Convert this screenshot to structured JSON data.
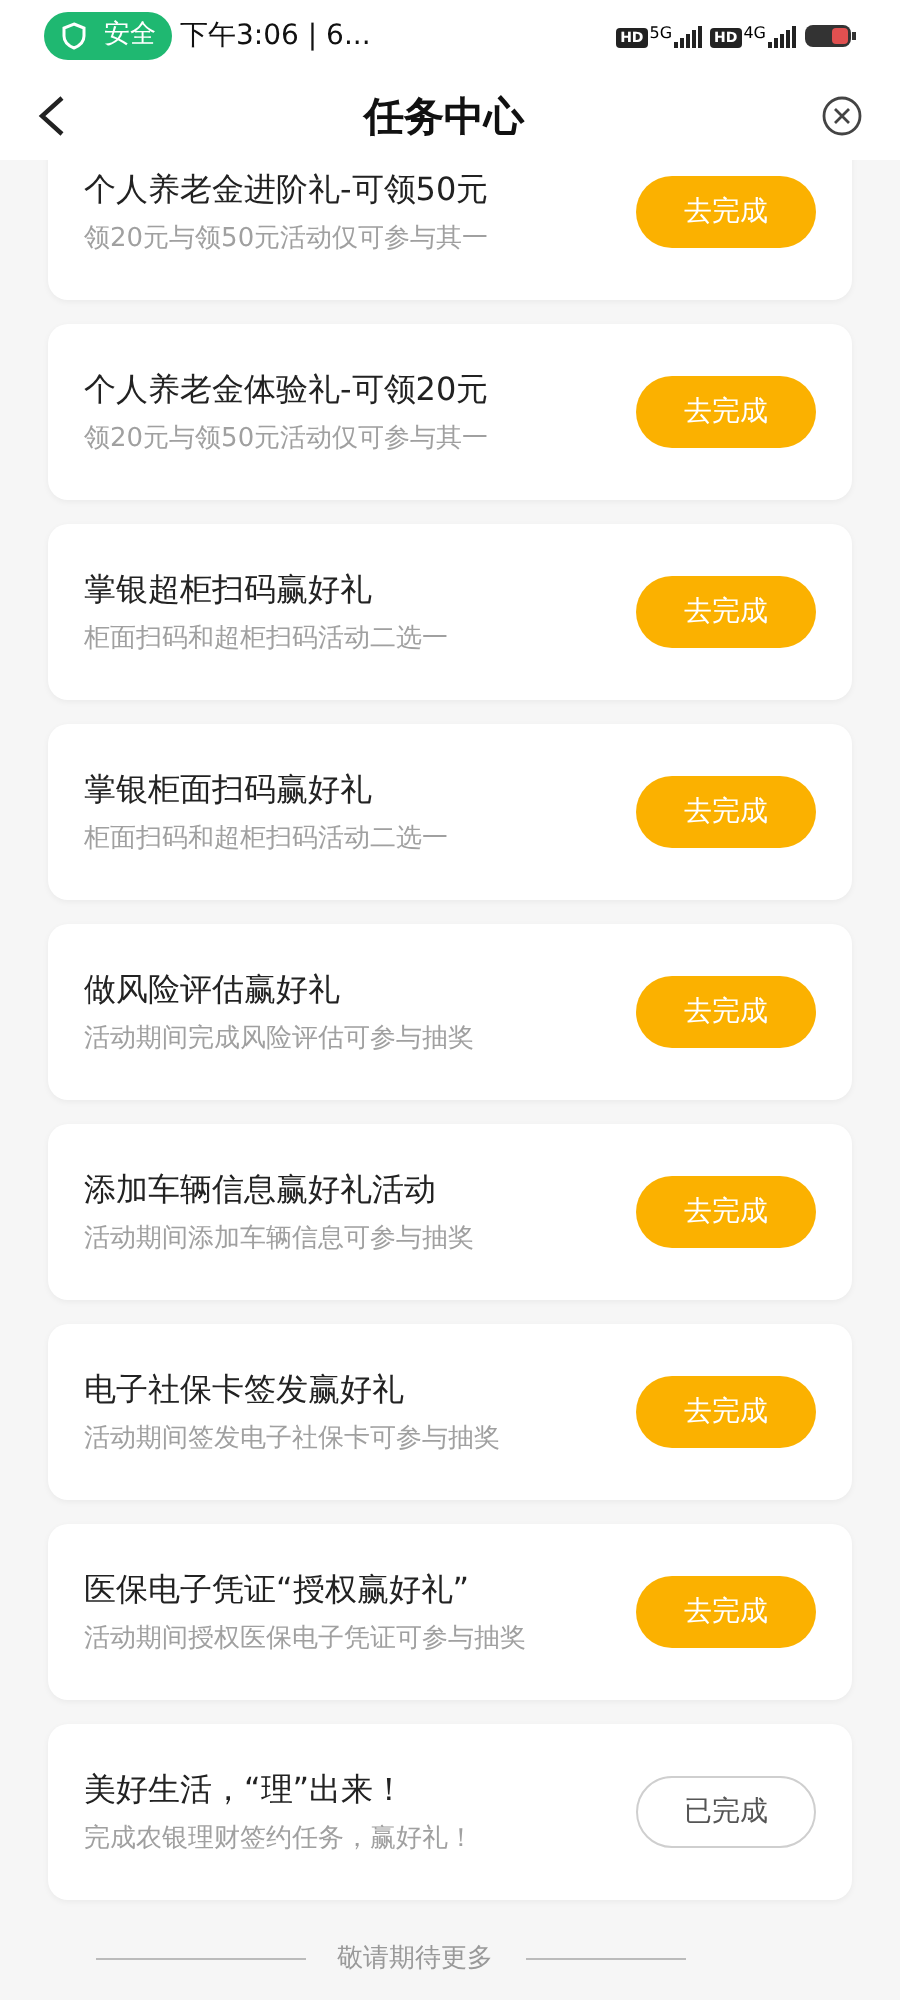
{
  "status_bar": {
    "security_label": "安全",
    "time": "下午3:06 | 6...",
    "hd_1": "HD",
    "network_1": "5G",
    "hd_2": "HD",
    "network_2": "4G"
  },
  "header": {
    "title": "任务中心"
  },
  "tasks": [
    {
      "title": "个人养老金进阶礼-可领50元",
      "subtitle": "领20元与领50元活动仅可参与其一",
      "button": "去完成",
      "completed": false
    },
    {
      "title": "个人养老金体验礼-可领20元",
      "subtitle": "领20元与领50元活动仅可参与其一",
      "button": "去完成",
      "completed": false
    },
    {
      "title": "掌银超柜扫码赢好礼",
      "subtitle": "柜面扫码和超柜扫码活动二选一",
      "button": "去完成",
      "completed": false
    },
    {
      "title": "掌银柜面扫码赢好礼",
      "subtitle": "柜面扫码和超柜扫码活动二选一",
      "button": "去完成",
      "completed": false
    },
    {
      "title": "做风险评估赢好礼",
      "subtitle": "活动期间完成风险评估可参与抽奖",
      "button": "去完成",
      "completed": false
    },
    {
      "title": "添加车辆信息赢好礼活动",
      "subtitle": "活动期间添加车辆信息可参与抽奖",
      "button": "去完成",
      "completed": false
    },
    {
      "title": "电子社保卡签发赢好礼",
      "subtitle": "活动期间签发电子社保卡可参与抽奖",
      "button": "去完成",
      "completed": false
    },
    {
      "title": "医保电子凭证“授权赢好礼”",
      "subtitle": "活动期间授权医保电子凭证可参与抽奖",
      "button": "去完成",
      "completed": false
    },
    {
      "title": "美好生活，“理”出来！",
      "subtitle": "完成农银理财签约任务，赢好礼！",
      "button": "已完成",
      "completed": true
    }
  ],
  "footer": {
    "text": "敬请期待更多"
  }
}
